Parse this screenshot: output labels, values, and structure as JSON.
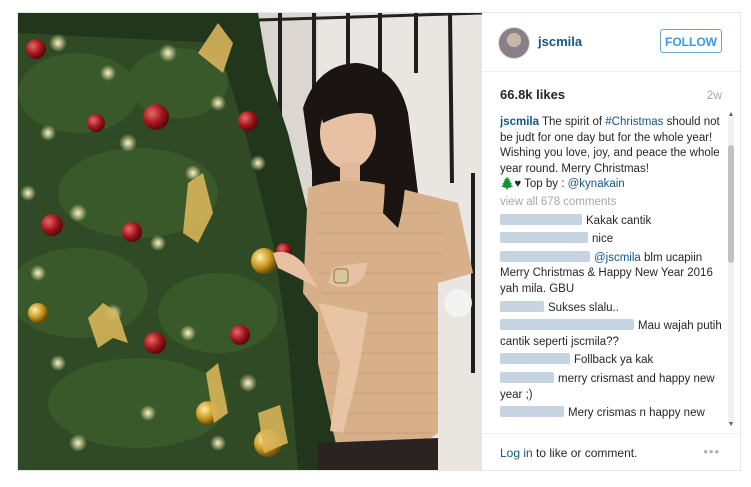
{
  "post": {
    "username": "jscmila",
    "follow_label": "FOLLOW",
    "likes": "66.8k likes",
    "age": "2w",
    "caption": {
      "user": "jscmila",
      "pre": " The spirit of ",
      "tag": "#Christmas",
      "post": " should not be judt for one day but for the whole year! Wishing you love, joy, and peace the whole year round. Merry Christmas!",
      "emoji": "🌲♥",
      "top_by_label": " Top by : ",
      "top_by_user": "@kynakain"
    },
    "view_all": "view all 678 comments",
    "comments": [
      {
        "text": "Kakak cantik"
      },
      {
        "text": "nice"
      },
      {
        "mention": "@jscmila",
        "text": " blm ucapiin Merry Christmas & Happy New Year 2016 yah mila. GBU"
      },
      {
        "text": "Sukses slalu.."
      },
      {
        "text": "Mau wajah putih cantik seperti jscmila??"
      },
      {
        "text": "Follback ya kak"
      },
      {
        "text": "merry crismast and happy new year ;)"
      },
      {
        "text": "Mery crismas n happy new year GBU"
      }
    ],
    "footer": {
      "login": "Log in",
      "rest": " to like or comment.",
      "more": "•••"
    }
  },
  "colors": {
    "link": "#125688",
    "follow": "#3897f0",
    "muted": "#a5a7aa"
  }
}
